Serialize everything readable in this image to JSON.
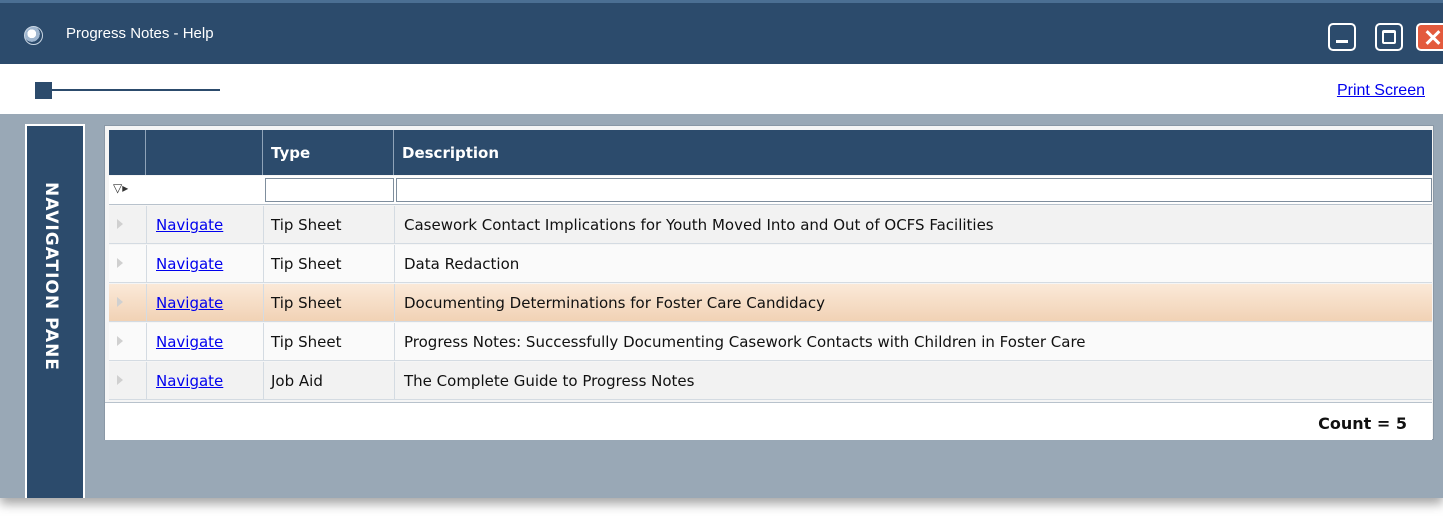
{
  "window": {
    "title": "Progress Notes  - Help",
    "buttons": [
      "minimize-icon",
      "maximize-icon",
      "close-icon"
    ]
  },
  "toolbar": {
    "print_label": "Print Screen"
  },
  "nav_pane": {
    "label": "NAVIGATION PANE"
  },
  "grid": {
    "columns": [
      "",
      "Type",
      "Description"
    ],
    "filters": {
      "type": "",
      "description": ""
    },
    "rows": [
      {
        "link": "Navigate",
        "type": "Tip Sheet",
        "description": "Casework Contact Implications for Youth Moved Into and Out of OCFS Facilities"
      },
      {
        "link": "Navigate",
        "type": "Tip Sheet",
        "description": "Data Redaction"
      },
      {
        "link": "Navigate",
        "type": "Tip Sheet",
        "description": "Documenting Determinations for Foster Care Candidacy"
      },
      {
        "link": "Navigate",
        "type": "Tip Sheet",
        "description": "Progress Notes: Successfully Documenting Casework Contacts with Children in Foster Care"
      },
      {
        "link": "Navigate",
        "type": "Job Aid",
        "description": "The Complete Guide to Progress Notes"
      }
    ],
    "selected_row": 3,
    "count_label": "Count = 5"
  },
  "colors": {
    "header": "#2c4b6c",
    "background": "#99a8b6",
    "selected_row": "#f1d2b5",
    "link": "#0000ee"
  }
}
